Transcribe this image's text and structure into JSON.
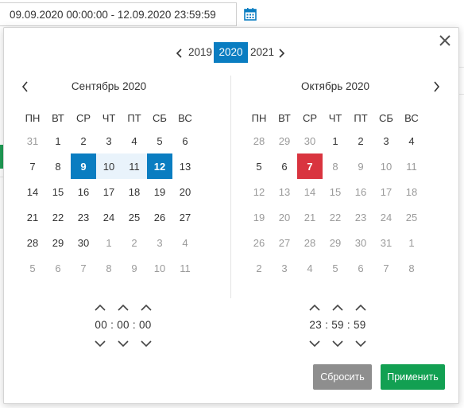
{
  "range_input": {
    "value": "09.09.2020 00:00:00 - 12.09.2020 23:59:59"
  },
  "year_nav": {
    "prev": "2019",
    "current": "2020",
    "next": "2021"
  },
  "weekdays": [
    "ПН",
    "ВТ",
    "СР",
    "ЧТ",
    "ПТ",
    "СБ",
    "ВС"
  ],
  "left_calendar": {
    "title": "Сентябрь 2020",
    "weeks": [
      [
        "31",
        "1",
        "2",
        "3",
        "4",
        "5",
        "6"
      ],
      [
        "7",
        "8",
        "9",
        "10",
        "11",
        "12",
        "13"
      ],
      [
        "14",
        "15",
        "16",
        "17",
        "18",
        "19",
        "20"
      ],
      [
        "21",
        "22",
        "23",
        "24",
        "25",
        "26",
        "27"
      ],
      [
        "28",
        "29",
        "30",
        "1",
        "2",
        "3",
        "4"
      ],
      [
        "5",
        "6",
        "7",
        "8",
        "9",
        "10",
        "11"
      ]
    ]
  },
  "right_calendar": {
    "title": "Октябрь 2020",
    "weeks": [
      [
        "28",
        "29",
        "30",
        "1",
        "2",
        "3",
        "4"
      ],
      [
        "5",
        "6",
        "7",
        "8",
        "9",
        "10",
        "11"
      ],
      [
        "12",
        "13",
        "14",
        "15",
        "16",
        "17",
        "18"
      ],
      [
        "19",
        "20",
        "21",
        "22",
        "23",
        "24",
        "25"
      ],
      [
        "26",
        "27",
        "28",
        "29",
        "30",
        "31",
        "1"
      ],
      [
        "2",
        "3",
        "4",
        "5",
        "6",
        "7",
        "8"
      ]
    ]
  },
  "time_start": {
    "text": "00 : 00 : 00"
  },
  "time_end": {
    "text": "23 : 59 : 59"
  },
  "buttons": {
    "reset": "Сбросить",
    "apply": "Применить"
  },
  "colors": {
    "accent": "#0a7dc1",
    "today": "#d9343f",
    "apply": "#12a052",
    "reset": "#8e8e8e",
    "range": "#e9f3fb"
  }
}
